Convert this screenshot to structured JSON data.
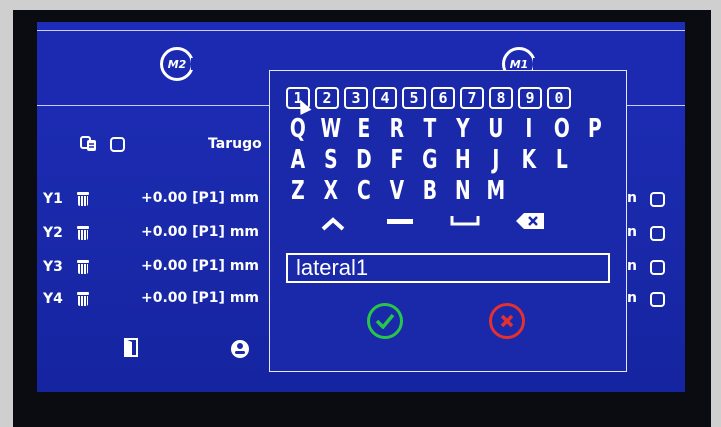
{
  "header": {
    "badge_left": "M2",
    "badge_right": "M1"
  },
  "panel": {
    "title": "Tarugo",
    "rows": [
      {
        "label": "Y1",
        "value": "+0.00 [P1]",
        "unit": "mm",
        "unit_right": "n"
      },
      {
        "label": "Y2",
        "value": "+0.00 [P1]",
        "unit": "mm",
        "unit_right": "n"
      },
      {
        "label": "Y3",
        "value": "+0.00 [P1]",
        "unit": "mm",
        "unit_right": "n"
      },
      {
        "label": "Y4",
        "value": "+0.00 [P1]",
        "unit": "mm",
        "unit_right": "n"
      }
    ]
  },
  "keyboard": {
    "numbers": [
      "1",
      "2",
      "3",
      "4",
      "5",
      "6",
      "7",
      "8",
      "9",
      "0"
    ],
    "row1": [
      "Q",
      "W",
      "E",
      "R",
      "T",
      "Y",
      "U",
      "I",
      "O",
      "P"
    ],
    "row2": [
      "A",
      "S",
      "D",
      "F",
      "G",
      "H",
      "J",
      "K",
      "L"
    ],
    "row3": [
      "Z",
      "X",
      "C",
      "V",
      "B",
      "N",
      "M"
    ],
    "input_value": "lateral1",
    "icons": {
      "shift": "chevron-up-icon",
      "dash": "dash-key-icon",
      "space": "space-key-icon",
      "backspace": "backspace-icon",
      "confirm": "check-icon",
      "cancel": "cancel-icon"
    },
    "colors": {
      "confirm": "#27c64a",
      "cancel": "#e33030"
    }
  }
}
